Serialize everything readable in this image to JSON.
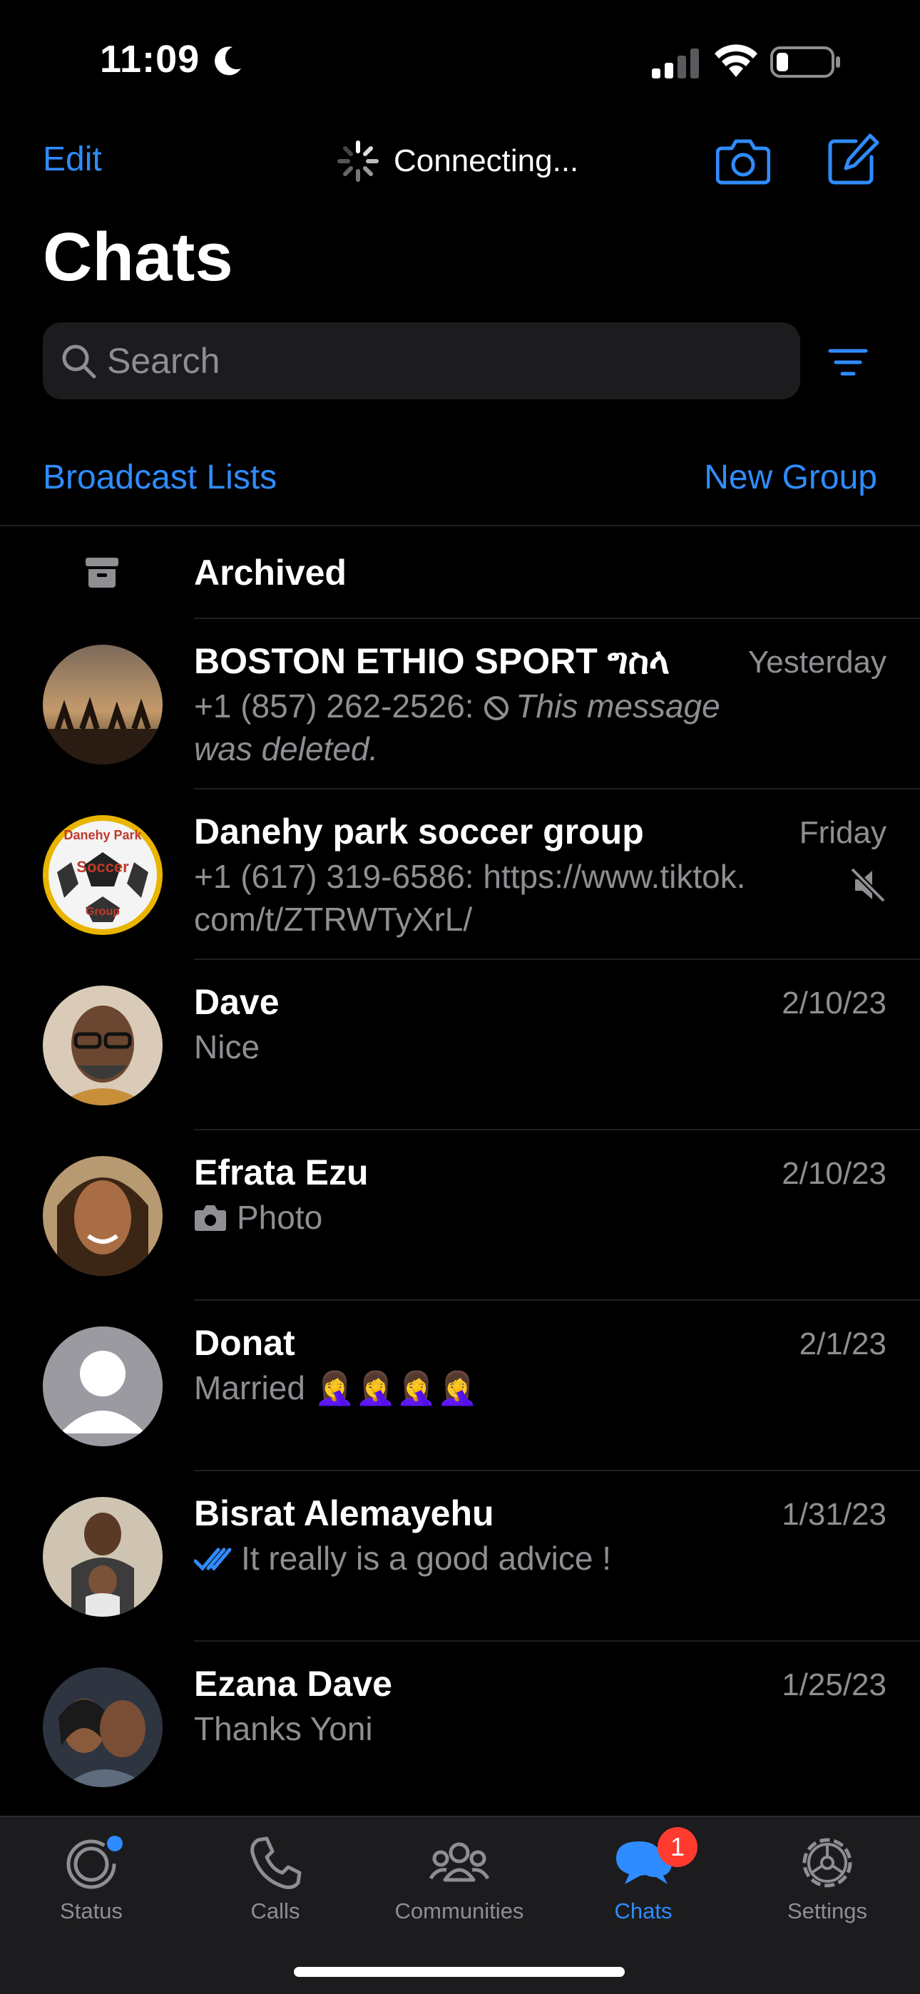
{
  "status_bar": {
    "time": "11:09"
  },
  "nav": {
    "edit_label": "Edit",
    "connecting_label": "Connecting...",
    "title": "Chats"
  },
  "search": {
    "placeholder": "Search"
  },
  "actions": {
    "broadcast_label": "Broadcast Lists",
    "new_group_label": "New Group"
  },
  "archived": {
    "label": "Archived"
  },
  "chats": [
    {
      "name": "BOSTON ETHIO SPORT ግስላ",
      "time": "Yesterday",
      "sender": "+1 (857) 262-2526: ",
      "preview": "This message was deleted.",
      "muted": false
    },
    {
      "name": "Danehy park soccer group",
      "time": "Friday",
      "sender": "+1 (617) 319-6586",
      "preview": ": https://www.tiktok.com/t/ZTRWTyXrL/",
      "muted": true
    },
    {
      "name": "Dave",
      "time": "2/10/23",
      "preview": "Nice"
    },
    {
      "name": "Efrata Ezu",
      "time": "2/10/23",
      "preview": "Photo"
    },
    {
      "name": "Donat",
      "time": "2/1/23",
      "preview": "Married 🤦‍♀️🤦‍♀️🤦‍♀️🤦‍♀️"
    },
    {
      "name": "Bisrat Alemayehu",
      "time": "1/31/23",
      "preview": "It really is a good advice !"
    },
    {
      "name": "Ezana Dave",
      "time": "1/25/23",
      "preview": "Thanks Yoni"
    }
  ],
  "tabs": [
    {
      "label": "Status",
      "icon": "status-icon"
    },
    {
      "label": "Calls",
      "icon": "phone-icon"
    },
    {
      "label": "Communities",
      "icon": "communities-icon"
    },
    {
      "label": "Chats",
      "icon": "chat-bubbles-icon",
      "badge": "1",
      "active": true
    },
    {
      "label": "Settings",
      "icon": "gear-icon"
    }
  ],
  "colors": {
    "accent": "#2f8cff",
    "badge": "#ff3b30",
    "secondary_text": "#8e8e93",
    "search_bg": "#1c1c1e"
  }
}
